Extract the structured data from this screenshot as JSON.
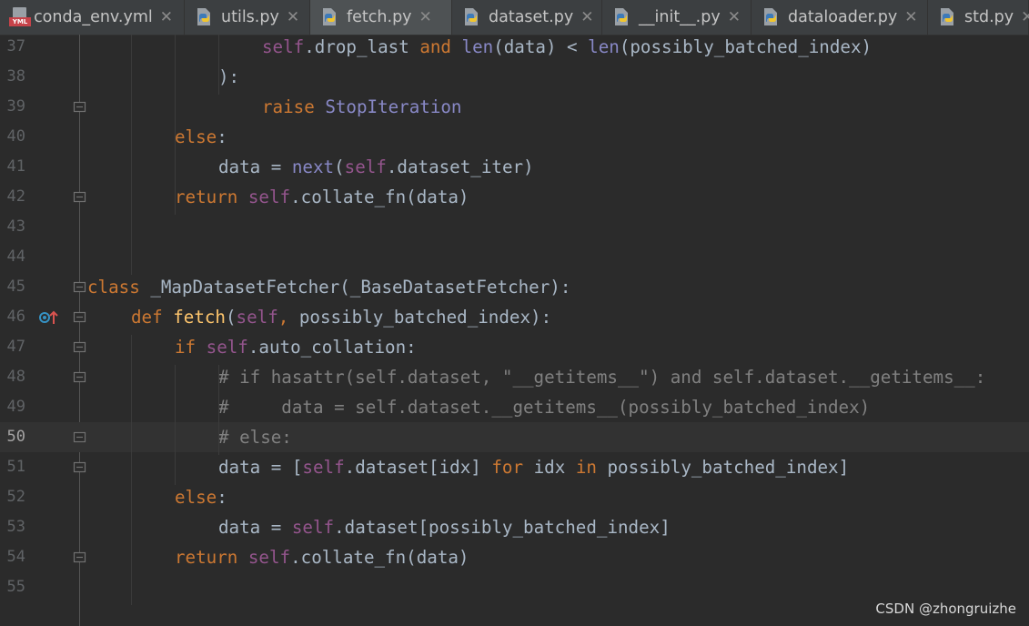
{
  "tabs": [
    {
      "label": "conda_env.yml",
      "icon": "yml-file-icon",
      "active": false
    },
    {
      "label": "utils.py",
      "icon": "python-file-icon",
      "active": false
    },
    {
      "label": "fetch.py",
      "icon": "python-file-icon",
      "active": true
    },
    {
      "label": "dataset.py",
      "icon": "python-file-icon",
      "active": false
    },
    {
      "label": "__init__.py",
      "icon": "python-file-icon",
      "active": false
    },
    {
      "label": "dataloader.py",
      "icon": "python-file-icon",
      "active": false
    },
    {
      "label": "std.py",
      "icon": "python-file-icon",
      "active": false
    }
  ],
  "tab_close_glyph": "✕",
  "yml_badge": "YML",
  "current_line": 50,
  "lines": [
    {
      "n": "37",
      "indent": 4,
      "tokens": [
        [
          "slf",
          "self"
        ],
        [
          "",
          "."
        ],
        [
          "",
          "drop_last "
        ],
        [
          "kw",
          "and"
        ],
        [
          "",
          " "
        ],
        [
          "bi",
          "len"
        ],
        [
          "",
          "(data) < "
        ],
        [
          "bi",
          "len"
        ],
        [
          "",
          "(possibly_batched_index)"
        ]
      ]
    },
    {
      "n": "38",
      "indent": 3,
      "tokens": [
        [
          "",
          "):"
        ]
      ]
    },
    {
      "n": "39",
      "indent": 4,
      "tokens": [
        [
          "kw",
          "raise "
        ],
        [
          "bi",
          "StopIteration"
        ]
      ]
    },
    {
      "n": "40",
      "indent": 2,
      "tokens": [
        [
          "kw",
          "else"
        ],
        [
          "",
          ":"
        ]
      ]
    },
    {
      "n": "41",
      "indent": 3,
      "tokens": [
        [
          "",
          "data = "
        ],
        [
          "bi",
          "next"
        ],
        [
          "",
          "("
        ],
        [
          "slf",
          "self"
        ],
        [
          "",
          ".dataset_iter)"
        ]
      ]
    },
    {
      "n": "42",
      "indent": 2,
      "tokens": [
        [
          "kw",
          "return "
        ],
        [
          "slf",
          "self"
        ],
        [
          "",
          ".collate_fn(data)"
        ]
      ]
    },
    {
      "n": "43",
      "indent": 0,
      "tokens": []
    },
    {
      "n": "44",
      "indent": 0,
      "tokens": []
    },
    {
      "n": "45",
      "indent": 0,
      "tokens": [
        [
          "kw",
          "class "
        ],
        [
          "",
          "_MapDatasetFetcher(_BaseDatasetFetcher):"
        ]
      ]
    },
    {
      "n": "46",
      "indent": 1,
      "tokens": [
        [
          "kw",
          "def "
        ],
        [
          "fn",
          "fetch"
        ],
        [
          "",
          "("
        ],
        [
          "slf",
          "self"
        ],
        [
          "kw",
          ", "
        ],
        [
          "",
          "possibly_batched_index):"
        ]
      ]
    },
    {
      "n": "47",
      "indent": 2,
      "tokens": [
        [
          "kw",
          "if "
        ],
        [
          "slf",
          "self"
        ],
        [
          "",
          ".auto_collation:"
        ]
      ]
    },
    {
      "n": "48",
      "indent": 3,
      "tokens": [
        [
          "cm",
          "# if hasattr(self.dataset, \"__getitems__\") and self.dataset.__getitems__:"
        ]
      ]
    },
    {
      "n": "49",
      "indent": 3,
      "tokens": [
        [
          "cm",
          "#     data = self.dataset.__getitems__(possibly_batched_index)"
        ]
      ]
    },
    {
      "n": "50",
      "indent": 3,
      "tokens": [
        [
          "cm",
          "# else:"
        ]
      ]
    },
    {
      "n": "51",
      "indent": 3,
      "tokens": [
        [
          "",
          "data = ["
        ],
        [
          "slf",
          "self"
        ],
        [
          "",
          ".dataset[idx] "
        ],
        [
          "kw",
          "for "
        ],
        [
          "",
          "idx "
        ],
        [
          "kw",
          "in "
        ],
        [
          "",
          "possibly_batched_index]"
        ]
      ]
    },
    {
      "n": "52",
      "indent": 2,
      "tokens": [
        [
          "kw",
          "else"
        ],
        [
          "",
          ":"
        ]
      ]
    },
    {
      "n": "53",
      "indent": 3,
      "tokens": [
        [
          "",
          "data = "
        ],
        [
          "slf",
          "self"
        ],
        [
          "",
          ".dataset[possibly_batched_index]"
        ]
      ]
    },
    {
      "n": "54",
      "indent": 2,
      "tokens": [
        [
          "kw",
          "return "
        ],
        [
          "slf",
          "self"
        ],
        [
          "",
          ".collate_fn(data)"
        ]
      ]
    },
    {
      "n": "55",
      "indent": 0,
      "tokens": []
    }
  ],
  "fold_lines": [
    "39",
    "42",
    "45",
    "46",
    "47",
    "48",
    "50",
    "51",
    "54"
  ],
  "override_marker_line": "46",
  "watermark": "CSDN @zhongruizhe",
  "colors": {
    "background": "#2b2b2b",
    "keyword": "#cc7832",
    "self": "#94558d",
    "builtin": "#8888c6",
    "function": "#ffc66d",
    "comment": "#808080",
    "text": "#a9b7c6"
  }
}
